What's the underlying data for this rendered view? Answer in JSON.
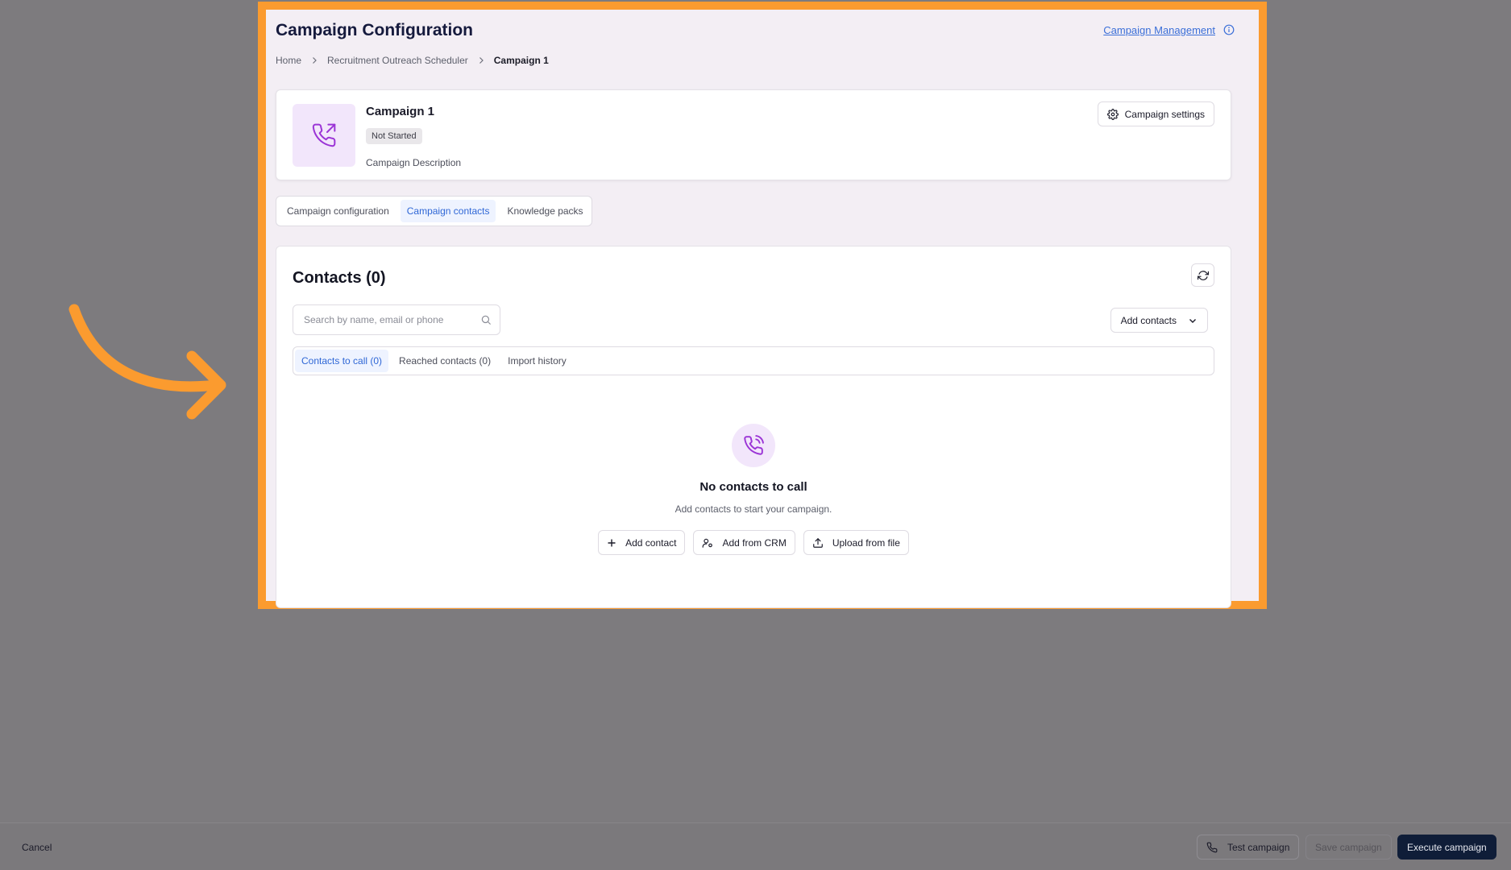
{
  "header": {
    "title": "Campaign Configuration",
    "management_link": "Campaign Management"
  },
  "breadcrumb": {
    "items": [
      "Home",
      "Recruitment Outreach Scheduler",
      "Campaign 1"
    ]
  },
  "campaign": {
    "name": "Campaign 1",
    "status": "Not Started",
    "description": "Campaign Description",
    "settings_label": "Campaign settings"
  },
  "tabs": [
    {
      "label": "Campaign configuration",
      "active": false
    },
    {
      "label": "Campaign contacts",
      "active": true
    },
    {
      "label": "Knowledge packs",
      "active": false
    }
  ],
  "contacts": {
    "title": "Contacts (0)",
    "search_placeholder": "Search by name, email or phone",
    "add_contacts_label": "Add contacts",
    "subtabs": [
      {
        "label": "Contacts to call (0)",
        "active": true
      },
      {
        "label": "Reached contacts (0)",
        "active": false
      },
      {
        "label": "Import history",
        "active": false
      }
    ],
    "empty": {
      "title": "No contacts to call",
      "subtitle": "Add contacts to start your campaign.",
      "actions": [
        "Add contact",
        "Add from CRM",
        "Upload from file"
      ]
    }
  },
  "footer": {
    "cancel": "Cancel",
    "test": "Test campaign",
    "save": "Save campaign",
    "execute": "Execute campaign"
  },
  "colors": {
    "highlight": "#fb9b2f",
    "accent": "#2f67d6",
    "icon_purple": "#9b35d6",
    "primary_dark": "#0f1d38"
  },
  "icons": [
    "curved-arrow-icon",
    "info-icon",
    "chevron-right-icon",
    "phone-outgoing-icon",
    "gear-icon",
    "refresh-icon",
    "search-icon",
    "chevron-down-icon",
    "phone-call-icon",
    "plus-icon",
    "user-icon",
    "upload-icon",
    "phone-icon"
  ]
}
